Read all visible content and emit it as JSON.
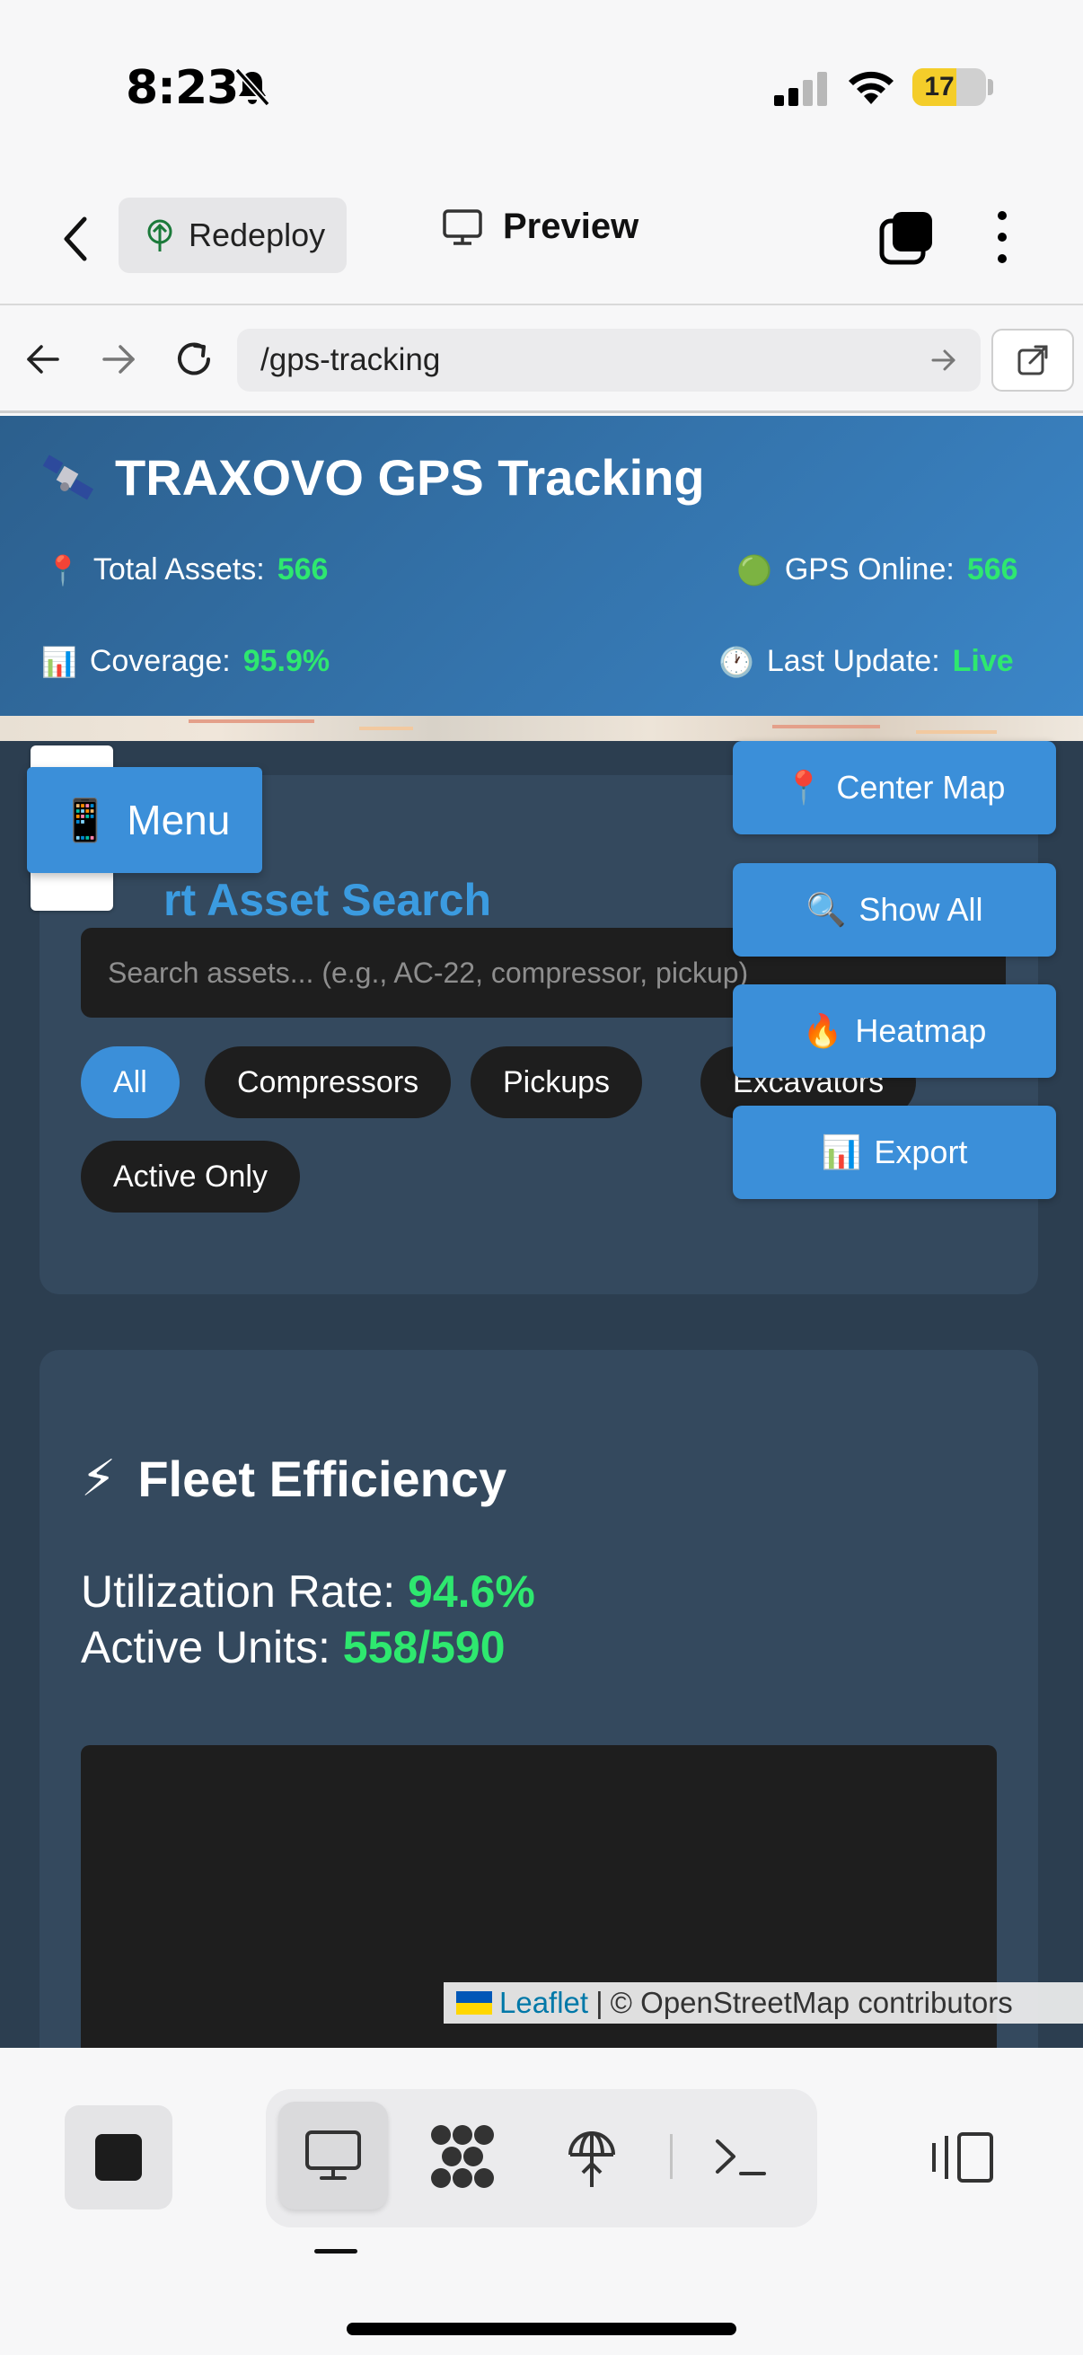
{
  "status_bar": {
    "time": "8:23",
    "battery": "17"
  },
  "app_toolbar": {
    "redeploy_label": "Redeploy",
    "preview_label": "Preview"
  },
  "browser": {
    "url": "/gps-tracking"
  },
  "header": {
    "title": "TRAXOVO GPS Tracking",
    "title_icon": "satellite-icon",
    "stats": {
      "total_assets": {
        "label": "Total Assets:",
        "value": "566",
        "icon": "📍"
      },
      "gps_online": {
        "label": "GPS Online:",
        "value": "566",
        "icon": "🟢"
      },
      "coverage": {
        "label": "Coverage:",
        "value": "95.9%",
        "icon": "📊"
      },
      "last_update": {
        "label": "Last Update:",
        "value": "Live",
        "icon": "🕐"
      }
    }
  },
  "menu": {
    "label": "Menu",
    "icon": "📱"
  },
  "search": {
    "title": "rt Asset Search",
    "placeholder": "Search assets... (e.g., AC-22, compressor, pickup)",
    "filters": [
      "All",
      "Compressors",
      "Pickups",
      "Excavators",
      "Active Only"
    ],
    "active_filter": "All"
  },
  "map_controls": {
    "center": {
      "label": "Center Map",
      "icon": "📍"
    },
    "show_all": {
      "label": "Show All",
      "icon": "🔍"
    },
    "heatmap": {
      "label": "Heatmap",
      "icon": "🔥"
    },
    "export": {
      "label": "Export",
      "icon": "📊"
    }
  },
  "fleet": {
    "title": "Fleet Efficiency",
    "icon": "⚡",
    "utilization_label": "Utilization Rate:",
    "utilization_value": "94.6%",
    "active_label": "Active Units:",
    "active_value": "558/590"
  },
  "attribution": {
    "leaflet": "Leaflet",
    "separator": "|",
    "osm": "© OpenStreetMap contributors"
  },
  "colors": {
    "accent": "#3b8fd9",
    "positive": "#2ee86f",
    "card": "#34495e",
    "page_bg": "#2c3e50"
  }
}
